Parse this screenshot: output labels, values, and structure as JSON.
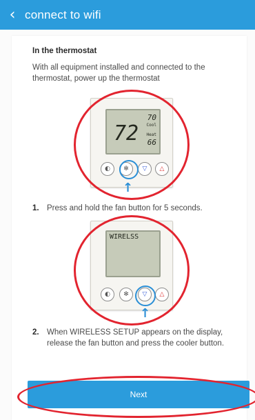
{
  "header": {
    "title": "connect to wifi"
  },
  "section": {
    "title": "In the thermostat",
    "intro": "With all equipment installed and connected to the thermostat, power up the thermostat"
  },
  "display1": {
    "temp": "72",
    "setpoint": "70",
    "setpoint_label": "Cool",
    "heat_value": "66",
    "heat_label": "Heat"
  },
  "display2": {
    "text": "WIRELSS"
  },
  "steps": [
    {
      "num": "1.",
      "text": "Press and hold the fan button for 5 seconds."
    },
    {
      "num": "2.",
      "text": "When WIRELESS SETUP appears on the display, release the fan button and press the cooler button."
    }
  ],
  "icons": [
    "back-chevron-icon",
    "mode-icon",
    "fan-icon",
    "down-arrow-icon",
    "up-arrow-icon",
    "pointer-arrow-icon"
  ],
  "colors": {
    "accent": "#2b9cdc",
    "highlight_ring": "#e2242f"
  },
  "next_button": {
    "label": "Next"
  }
}
